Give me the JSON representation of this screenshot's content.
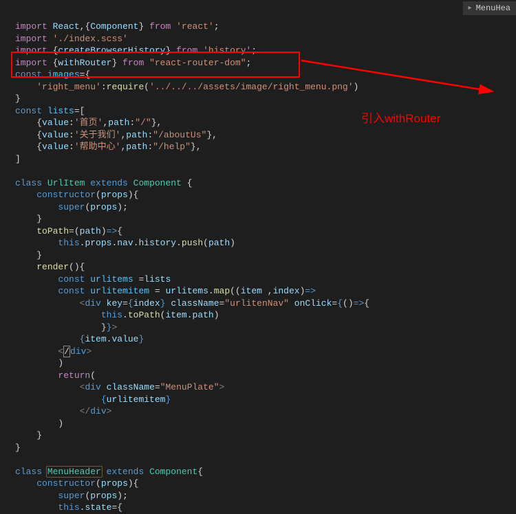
{
  "breadcrumb": {
    "label": "MenuHea"
  },
  "annotation": {
    "text": "引入withRouter"
  },
  "code": {
    "lines": [
      {
        "t": "import",
        "parts": [
          {
            "c": "kw2",
            "v": "import"
          },
          {
            "c": "",
            "v": " "
          },
          {
            "c": "var",
            "v": "React"
          },
          {
            "c": "",
            "v": ","
          },
          {
            "c": "",
            "v": "{"
          },
          {
            "c": "var",
            "v": "Component"
          },
          {
            "c": "",
            "v": "} "
          },
          {
            "c": "kw2",
            "v": "from"
          },
          {
            "c": "",
            "v": " "
          },
          {
            "c": "str",
            "v": "'react'"
          },
          {
            "c": "",
            "v": ";"
          }
        ]
      },
      {
        "t": "import",
        "parts": [
          {
            "c": "kw2",
            "v": "import"
          },
          {
            "c": "",
            "v": " "
          },
          {
            "c": "str",
            "v": "'./index.scss'"
          }
        ]
      },
      {
        "t": "import",
        "parts": [
          {
            "c": "kw2",
            "v": "import"
          },
          {
            "c": "",
            "v": " {"
          },
          {
            "c": "var",
            "v": "createBrowserHistory"
          },
          {
            "c": "",
            "v": "} "
          },
          {
            "c": "kw2",
            "v": "from"
          },
          {
            "c": "",
            "v": " "
          },
          {
            "c": "str",
            "v": "'history'"
          },
          {
            "c": "",
            "v": ";"
          }
        ]
      },
      {
        "t": "import",
        "parts": [
          {
            "c": "kw2",
            "v": "import"
          },
          {
            "c": "",
            "v": " {"
          },
          {
            "c": "var",
            "v": "withRouter"
          },
          {
            "c": "",
            "v": "} "
          },
          {
            "c": "kw2",
            "v": "from"
          },
          {
            "c": "",
            "v": " "
          },
          {
            "c": "str",
            "v": "\"react-router-dom\""
          },
          {
            "c": "",
            "v": ";"
          }
        ]
      },
      {
        "t": "const",
        "parts": [
          {
            "c": "kw",
            "v": "const"
          },
          {
            "c": "",
            "v": " "
          },
          {
            "c": "const",
            "v": "images"
          },
          {
            "c": "",
            "v": "="
          },
          {
            "c": "",
            "v": "{"
          }
        ]
      },
      {
        "t": "prop",
        "parts": [
          {
            "c": "",
            "v": "    "
          },
          {
            "c": "str",
            "v": "'right_menu'"
          },
          {
            "c": "",
            "v": ":"
          },
          {
            "c": "fn",
            "v": "require"
          },
          {
            "c": "",
            "v": "("
          },
          {
            "c": "str",
            "v": "'../../../assets/image/right_menu.png'"
          },
          {
            "c": "",
            "v": ")"
          }
        ]
      },
      {
        "t": "brace",
        "parts": [
          {
            "c": "",
            "v": "}"
          }
        ]
      },
      {
        "t": "const",
        "parts": [
          {
            "c": "kw",
            "v": "const"
          },
          {
            "c": "",
            "v": " "
          },
          {
            "c": "const",
            "v": "lists"
          },
          {
            "c": "",
            "v": "=["
          }
        ]
      },
      {
        "t": "obj",
        "parts": [
          {
            "c": "",
            "v": "    {"
          },
          {
            "c": "prop",
            "v": "value"
          },
          {
            "c": "",
            "v": ":"
          },
          {
            "c": "str",
            "v": "'首页'"
          },
          {
            "c": "",
            "v": ","
          },
          {
            "c": "prop",
            "v": "path"
          },
          {
            "c": "",
            "v": ":"
          },
          {
            "c": "str",
            "v": "\"/\""
          },
          {
            "c": "",
            "v": "},"
          }
        ]
      },
      {
        "t": "obj",
        "parts": [
          {
            "c": "",
            "v": "    {"
          },
          {
            "c": "prop",
            "v": "value"
          },
          {
            "c": "",
            "v": ":"
          },
          {
            "c": "str",
            "v": "'关于我们'"
          },
          {
            "c": "",
            "v": ","
          },
          {
            "c": "prop",
            "v": "path"
          },
          {
            "c": "",
            "v": ":"
          },
          {
            "c": "str",
            "v": "\"/aboutUs\""
          },
          {
            "c": "",
            "v": "},"
          }
        ]
      },
      {
        "t": "obj",
        "parts": [
          {
            "c": "",
            "v": "    {"
          },
          {
            "c": "prop",
            "v": "value"
          },
          {
            "c": "",
            "v": ":"
          },
          {
            "c": "str",
            "v": "'帮助中心'"
          },
          {
            "c": "",
            "v": ","
          },
          {
            "c": "prop",
            "v": "path"
          },
          {
            "c": "",
            "v": ":"
          },
          {
            "c": "str",
            "v": "\"/help\""
          },
          {
            "c": "",
            "v": "},"
          }
        ]
      },
      {
        "t": "brace",
        "parts": [
          {
            "c": "",
            "v": "]"
          }
        ]
      },
      {
        "t": "blank",
        "parts": []
      },
      {
        "t": "class",
        "parts": [
          {
            "c": "kw",
            "v": "class"
          },
          {
            "c": "",
            "v": " "
          },
          {
            "c": "cls",
            "v": "UrlItem"
          },
          {
            "c": "",
            "v": " "
          },
          {
            "c": "kw",
            "v": "extends"
          },
          {
            "c": "",
            "v": " "
          },
          {
            "c": "cls",
            "v": "Component"
          },
          {
            "c": "",
            "v": " {"
          }
        ]
      },
      {
        "t": "method",
        "parts": [
          {
            "c": "",
            "v": "    "
          },
          {
            "c": "kw",
            "v": "constructor"
          },
          {
            "c": "",
            "v": "("
          },
          {
            "c": "var",
            "v": "props"
          },
          {
            "c": "",
            "v": "){"
          }
        ]
      },
      {
        "t": "stmt",
        "parts": [
          {
            "c": "",
            "v": "        "
          },
          {
            "c": "kw",
            "v": "super"
          },
          {
            "c": "",
            "v": "("
          },
          {
            "c": "var",
            "v": "props"
          },
          {
            "c": "",
            "v": ");"
          }
        ]
      },
      {
        "t": "brace",
        "parts": [
          {
            "c": "",
            "v": "    }"
          }
        ]
      },
      {
        "t": "method",
        "parts": [
          {
            "c": "",
            "v": "    "
          },
          {
            "c": "fn",
            "v": "toPath"
          },
          {
            "c": "",
            "v": "=("
          },
          {
            "c": "var",
            "v": "path"
          },
          {
            "c": "",
            "v": ")"
          },
          {
            "c": "kw",
            "v": "=>"
          },
          {
            "c": "",
            "v": "{"
          }
        ]
      },
      {
        "t": "stmt",
        "parts": [
          {
            "c": "",
            "v": "        "
          },
          {
            "c": "this",
            "v": "this"
          },
          {
            "c": "",
            "v": "."
          },
          {
            "c": "var",
            "v": "props"
          },
          {
            "c": "",
            "v": "."
          },
          {
            "c": "var",
            "v": "nav"
          },
          {
            "c": "",
            "v": "."
          },
          {
            "c": "var",
            "v": "history"
          },
          {
            "c": "",
            "v": "."
          },
          {
            "c": "fn",
            "v": "push"
          },
          {
            "c": "",
            "v": "("
          },
          {
            "c": "var",
            "v": "path"
          },
          {
            "c": "",
            "v": ")"
          }
        ]
      },
      {
        "t": "brace",
        "parts": [
          {
            "c": "",
            "v": "    }"
          }
        ]
      },
      {
        "t": "method",
        "parts": [
          {
            "c": "",
            "v": "    "
          },
          {
            "c": "fn",
            "v": "render"
          },
          {
            "c": "",
            "v": "(){"
          }
        ]
      },
      {
        "t": "stmt",
        "parts": [
          {
            "c": "",
            "v": "        "
          },
          {
            "c": "kw",
            "v": "const"
          },
          {
            "c": "",
            "v": " "
          },
          {
            "c": "const",
            "v": "urlitems"
          },
          {
            "c": "",
            "v": " ="
          },
          {
            "c": "var",
            "v": "lists"
          }
        ]
      },
      {
        "t": "stmt",
        "parts": [
          {
            "c": "",
            "v": "        "
          },
          {
            "c": "kw",
            "v": "const"
          },
          {
            "c": "",
            "v": " "
          },
          {
            "c": "const",
            "v": "urlitemitem"
          },
          {
            "c": "",
            "v": " = "
          },
          {
            "c": "var",
            "v": "urlitems"
          },
          {
            "c": "",
            "v": "."
          },
          {
            "c": "fn",
            "v": "map"
          },
          {
            "c": "",
            "v": "(("
          },
          {
            "c": "var",
            "v": "item"
          },
          {
            "c": "",
            "v": " ,"
          },
          {
            "c": "var",
            "v": "index"
          },
          {
            "c": "",
            "v": ")"
          },
          {
            "c": "kw",
            "v": "=>"
          }
        ]
      },
      {
        "t": "jsx",
        "parts": [
          {
            "c": "",
            "v": "            "
          },
          {
            "c": "tag",
            "v": "<"
          },
          {
            "c": "tagname",
            "v": "div"
          },
          {
            "c": "",
            "v": " "
          },
          {
            "c": "attr",
            "v": "key"
          },
          {
            "c": "",
            "v": "="
          },
          {
            "c": "jsxbrace",
            "v": "{"
          },
          {
            "c": "var",
            "v": "index"
          },
          {
            "c": "jsxbrace",
            "v": "}"
          },
          {
            "c": "",
            "v": " "
          },
          {
            "c": "attr",
            "v": "className"
          },
          {
            "c": "",
            "v": "="
          },
          {
            "c": "str",
            "v": "\"urlitenNav\""
          },
          {
            "c": "",
            "v": " "
          },
          {
            "c": "attr",
            "v": "onClick"
          },
          {
            "c": "",
            "v": "="
          },
          {
            "c": "jsxbrace",
            "v": "{"
          },
          {
            "c": "",
            "v": "()"
          },
          {
            "c": "kw",
            "v": "=>"
          },
          {
            "c": "",
            "v": "{"
          }
        ]
      },
      {
        "t": "stmt",
        "parts": [
          {
            "c": "",
            "v": "                "
          },
          {
            "c": "this",
            "v": "this"
          },
          {
            "c": "",
            "v": "."
          },
          {
            "c": "fn",
            "v": "toPath"
          },
          {
            "c": "",
            "v": "("
          },
          {
            "c": "var",
            "v": "item"
          },
          {
            "c": "",
            "v": "."
          },
          {
            "c": "var",
            "v": "path"
          },
          {
            "c": "",
            "v": ")"
          }
        ]
      },
      {
        "t": "jsx",
        "parts": [
          {
            "c": "",
            "v": "                }"
          },
          {
            "c": "jsxbrace",
            "v": "}"
          },
          {
            "c": "tag",
            "v": ">"
          }
        ]
      },
      {
        "t": "jsx",
        "parts": [
          {
            "c": "",
            "v": "            "
          },
          {
            "c": "jsxbrace",
            "v": "{"
          },
          {
            "c": "var",
            "v": "item"
          },
          {
            "c": "",
            "v": "."
          },
          {
            "c": "var",
            "v": "value"
          },
          {
            "c": "jsxbrace",
            "v": "}"
          }
        ]
      },
      {
        "t": "jsx",
        "parts": [
          {
            "c": "",
            "v": "        "
          },
          {
            "c": "tag",
            "v": "<"
          },
          {
            "c": "cursor-box",
            "v": "/"
          },
          {
            "c": "tagname",
            "v": "div"
          },
          {
            "c": "tag",
            "v": ">"
          }
        ]
      },
      {
        "t": "brace",
        "parts": [
          {
            "c": "",
            "v": "        )"
          }
        ]
      },
      {
        "t": "stmt",
        "parts": [
          {
            "c": "",
            "v": "        "
          },
          {
            "c": "kw2",
            "v": "return"
          },
          {
            "c": "",
            "v": "("
          }
        ]
      },
      {
        "t": "jsx",
        "parts": [
          {
            "c": "",
            "v": "            "
          },
          {
            "c": "tag",
            "v": "<"
          },
          {
            "c": "tagname",
            "v": "div"
          },
          {
            "c": "",
            "v": " "
          },
          {
            "c": "attr",
            "v": "className"
          },
          {
            "c": "",
            "v": "="
          },
          {
            "c": "str",
            "v": "\"MenuPlate\""
          },
          {
            "c": "tag",
            "v": ">"
          }
        ]
      },
      {
        "t": "jsx",
        "parts": [
          {
            "c": "",
            "v": "                "
          },
          {
            "c": "jsxbrace",
            "v": "{"
          },
          {
            "c": "var",
            "v": "urlitemitem"
          },
          {
            "c": "jsxbrace",
            "v": "}"
          }
        ]
      },
      {
        "t": "jsx",
        "parts": [
          {
            "c": "",
            "v": "            "
          },
          {
            "c": "tag",
            "v": "</"
          },
          {
            "c": "tagname",
            "v": "div"
          },
          {
            "c": "tag",
            "v": ">"
          }
        ]
      },
      {
        "t": "brace",
        "parts": [
          {
            "c": "",
            "v": "        )"
          }
        ]
      },
      {
        "t": "brace",
        "parts": [
          {
            "c": "",
            "v": "    }"
          }
        ]
      },
      {
        "t": "brace",
        "parts": [
          {
            "c": "",
            "v": "}"
          }
        ]
      },
      {
        "t": "blank",
        "parts": []
      },
      {
        "t": "class",
        "parts": [
          {
            "c": "kw",
            "v": "class"
          },
          {
            "c": "",
            "v": " "
          },
          {
            "c": "cls word-hl",
            "v": "MenuHeader"
          },
          {
            "c": "",
            "v": " "
          },
          {
            "c": "kw",
            "v": "extends"
          },
          {
            "c": "",
            "v": " "
          },
          {
            "c": "cls",
            "v": "Component"
          },
          {
            "c": "",
            "v": "{"
          }
        ]
      },
      {
        "t": "method",
        "parts": [
          {
            "c": "",
            "v": "    "
          },
          {
            "c": "kw",
            "v": "constructor"
          },
          {
            "c": "",
            "v": "("
          },
          {
            "c": "var",
            "v": "props"
          },
          {
            "c": "",
            "v": "){"
          }
        ]
      },
      {
        "t": "stmt",
        "parts": [
          {
            "c": "",
            "v": "        "
          },
          {
            "c": "kw",
            "v": "super"
          },
          {
            "c": "",
            "v": "("
          },
          {
            "c": "var",
            "v": "props"
          },
          {
            "c": "",
            "v": ");"
          }
        ]
      },
      {
        "t": "stmt",
        "parts": [
          {
            "c": "",
            "v": "        "
          },
          {
            "c": "this",
            "v": "this"
          },
          {
            "c": "",
            "v": "."
          },
          {
            "c": "var",
            "v": "state"
          },
          {
            "c": "",
            "v": "={"
          }
        ]
      }
    ]
  }
}
